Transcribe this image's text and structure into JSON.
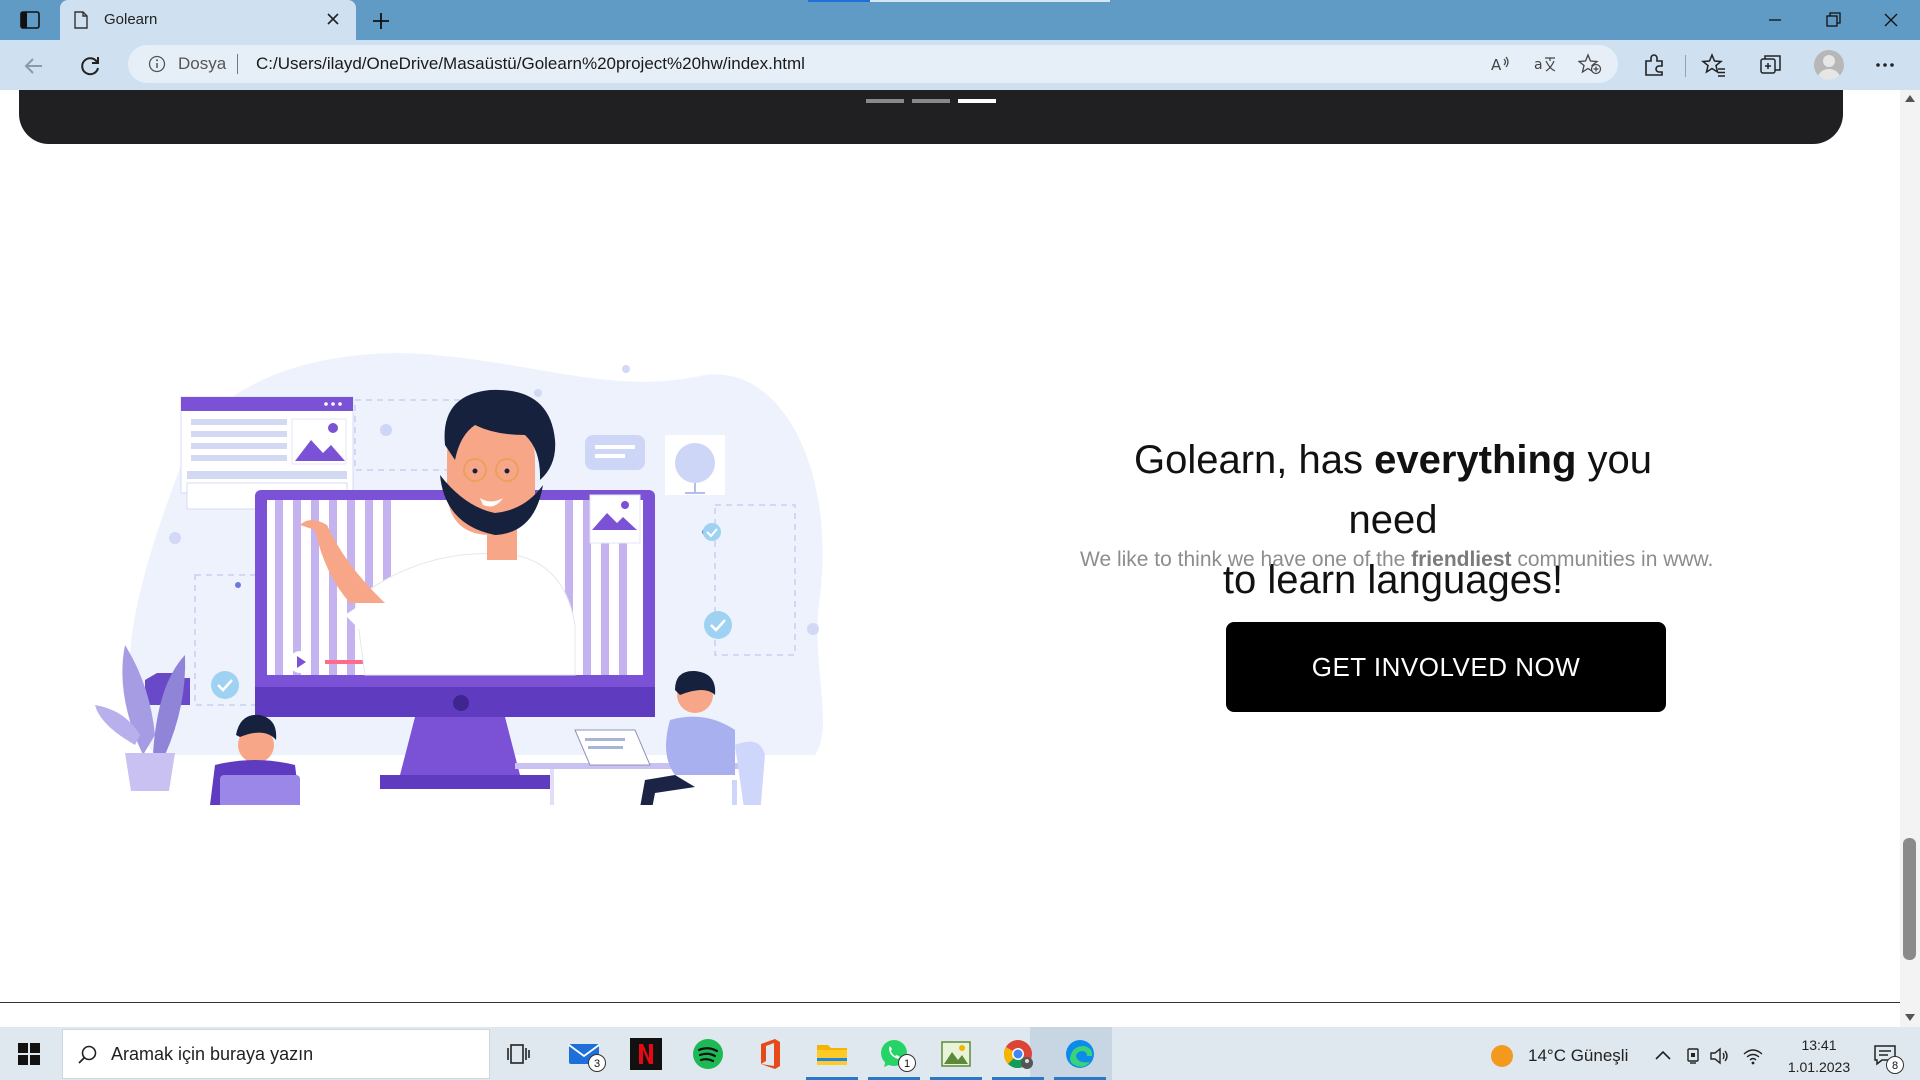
{
  "browser": {
    "tab_title": "Golearn",
    "scheme_label": "Dosya",
    "url": "C:/Users/ilayd/OneDrive/Masaüstü/Golearn%20project%20hw/index.html"
  },
  "page": {
    "carousel": {
      "dots": 3,
      "active_index": 2
    },
    "heading": {
      "part1": "Golearn, has ",
      "bold": "everything",
      "part2": " you need",
      "line2": "to learn languages!"
    },
    "subtext": {
      "part1": "We like to think we have one of the ",
      "bold": "friendliest",
      "part2": " communities in www."
    },
    "cta_label": "GET INVOLVED NOW"
  },
  "taskbar": {
    "search_placeholder": "Aramak için buraya yazın",
    "apps": [
      "task-view",
      "mail",
      "netflix",
      "spotify",
      "office",
      "file-explorer",
      "whatsapp",
      "photos",
      "chrome",
      "edge"
    ],
    "mail_badge": "3",
    "whatsapp_badge": "1",
    "weather": "14°C  Güneşli",
    "time": "13:41",
    "date": "1.01.2023",
    "notification_count": "8"
  },
  "colors": {
    "titlebar": "#5f9bc4",
    "toolbar": "#cfe1f0",
    "hero": "#202022",
    "cta_bg": "#000000",
    "illustration_purple": "#7b52d6"
  }
}
